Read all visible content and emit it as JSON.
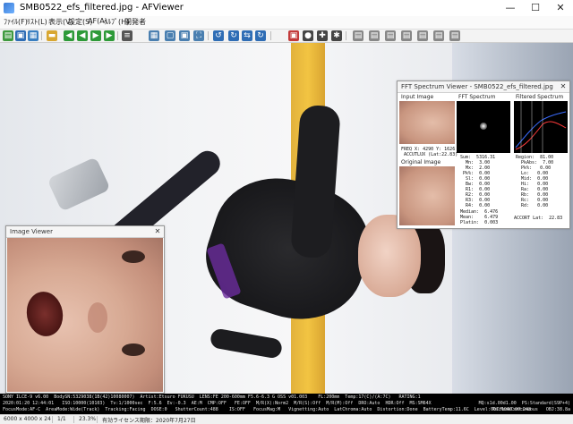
{
  "window": {
    "title": "SMB0522_efs_filtered.jpg - AFViewer",
    "minimize": "—",
    "maximize": "☐",
    "close": "✕"
  },
  "menu": [
    {
      "label": "ﾌｧｲﾙ(F)"
    },
    {
      "label": "ﾘｽﾄ(L)"
    },
    {
      "label": "表示(V)"
    },
    {
      "label": "設定(S)"
    },
    {
      "label": "AF(A)"
    },
    {
      "label": "ﾍﾙﾌﾟ(H)"
    },
    {
      "label": "開発者"
    }
  ],
  "toolbar": [
    {
      "icon": "open-folder-icon",
      "glyph": "▤",
      "color": "#3f9a3f"
    },
    {
      "icon": "image-icon",
      "glyph": "▣",
      "color": "#2f6db5"
    },
    {
      "icon": "thumbnails-icon",
      "glyph": "▦",
      "color": "#3a7fc1"
    },
    {
      "icon": "folder-icon",
      "glyph": "▬",
      "color": "#d8a732"
    },
    {
      "icon": "back-icon",
      "glyph": "◀",
      "color": "#2e9a39"
    },
    {
      "icon": "prev-icon",
      "glyph": "◀",
      "color": "#2e9a39"
    },
    {
      "icon": "next-icon",
      "glyph": "▶",
      "color": "#2e9a39"
    },
    {
      "icon": "forward-icon",
      "glyph": "▶",
      "color": "#2e9a39"
    },
    {
      "icon": "list-icon",
      "glyph": "≡",
      "color": "#555555"
    },
    {
      "icon": "grid-icon",
      "glyph": "▦",
      "color": "#4a7fb0"
    },
    {
      "icon": "fit-icon",
      "glyph": "▢",
      "color": "#4a7fb0"
    },
    {
      "icon": "zoom-icon",
      "glyph": "▣",
      "color": "#4a7fb0"
    },
    {
      "icon": "fullscreen-icon",
      "glyph": "⛶",
      "color": "#4a7fb0"
    },
    {
      "icon": "rotate-left-icon",
      "glyph": "↺",
      "color": "#2f6db5"
    },
    {
      "icon": "rotate-right-icon",
      "glyph": "↻",
      "color": "#2f6db5"
    },
    {
      "icon": "flip-icon",
      "glyph": "⇆",
      "color": "#2f6db5"
    },
    {
      "icon": "refresh-icon",
      "glyph": "↻",
      "color": "#2f6db5"
    },
    {
      "icon": "af-point-icon",
      "glyph": "▣",
      "color": "#c23a3a"
    },
    {
      "icon": "marker-icon",
      "glyph": "●",
      "color": "#444444"
    },
    {
      "icon": "cross-icon",
      "glyph": "✚",
      "color": "#444444"
    },
    {
      "icon": "person-icon",
      "glyph": "✱",
      "color": "#444444"
    },
    {
      "icon": "doc-icon",
      "glyph": "▤",
      "color": "#888888"
    },
    {
      "icon": "doc2-icon",
      "glyph": "▤",
      "color": "#888888"
    },
    {
      "icon": "doc3-icon",
      "glyph": "▤",
      "color": "#888888"
    },
    {
      "icon": "doc4-icon",
      "glyph": "▤",
      "color": "#888888"
    },
    {
      "icon": "doc5-icon",
      "glyph": "▤",
      "color": "#888888"
    },
    {
      "icon": "settings-icon",
      "glyph": "▤",
      "color": "#888888"
    },
    {
      "icon": "info-icon",
      "glyph": "▤",
      "color": "#888888"
    }
  ],
  "image_viewer": {
    "title": "Image Viewer",
    "close": "✕"
  },
  "fft_viewer": {
    "title": "FFT Spectrum Viewer  - SMB0522_efs_filtered.jpg",
    "close": "✕",
    "input_label": "Input Image",
    "spectrum_label": "FFT Spectrum",
    "filtered_label": "Filtered Spectrum",
    "original_label": "Original Image",
    "freq_text": "FREQ X: 4290 Y: 1626\n ACCUTLUX (Lat:22.83)",
    "spec_values": "Sum:  5316.31\n  Mn:  3.00\n  Mx:  2.00\n Pk%:  0.00\n  Sl:  0.00\n  Bw:  0.00\n  R1:  0.00\n  R2:  0.00\n  R3:  0.00\n  R4:  0.00",
    "medians": "Median:  6.476\nMean:    6.479\nPlatin:  0.003",
    "filt_values": "Region:  81.00\n  PkAbs:  7.00\n  Pk%:   0.00\n  Lo:   0.00\n  Mid:  0.00\n  Hi:   0.00\n  Ra:   0.00\n  Rb:   0.00\n  Rc:   0.00\n  Rd:   0.00",
    "accort": "ACCORT Lat:  22.83"
  },
  "exif": {
    "line1": "SONY ILCE-9 v6.00  BodySN:5329038(1B(42)10080007)  Artist:Etsuro FUKUSU  LENS:FE 200-600mm F5.6-6.3 G OSS v01.003    FL:200mm  Temp:17(C)/(A:7C)   RATING:1",
    "line2": "2020:01:20 12:44:01   ISO:10000(10103)  Tv:1/1000sec  F:5.6  Ev:-0.3  AE:M  CMP:OFF   FE:OFF  M/R(X):Norm2  M/R(S):Off  M/R(M):Off  DRO:Auto  HDR:Off  MS:SM64X",
    "line3": "FocusMode:AF-C  AreaMode:Wide(Track)  Tracking:Facing  DOSE:0   ShutterCount:488    IS:OFF   FocusMag:M   Vignetting:Auto  LatChroma:Auto  Distortion:Done  BatteryTemp:11.6C  Level:001:1040:00:248",
    "line1_right": "MQ:s1d.00d1.00  PS:Standard(S9P+4)",
    "line3_right": "RelModeContinuous   OBJ:38.8a"
  },
  "status": {
    "size": "6000 x 4000 x 24",
    "index": "1/1",
    "zoom": "23.3%",
    "license": "有効ライセンス期限：2020年7月27日"
  }
}
